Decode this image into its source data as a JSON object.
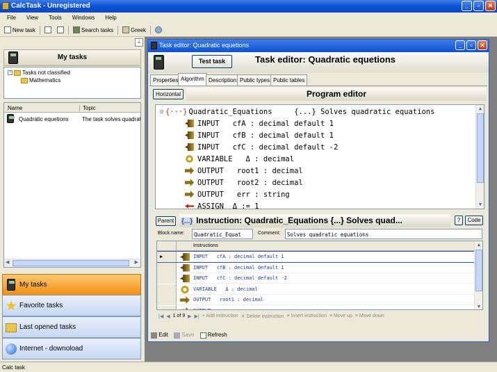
{
  "app": {
    "title": "CalcTask - Unregistered",
    "window_buttons": [
      "_",
      "▫",
      "✕"
    ]
  },
  "menu": [
    "File",
    "View",
    "Tools",
    "Windows",
    "Help"
  ],
  "toolbar": {
    "new_task": "New task",
    "search_tasks": "Search tasks",
    "greek": "Greek"
  },
  "left": {
    "header": "My tasks",
    "tree": {
      "root": "Tasks not classified",
      "child": "Mathematics"
    },
    "list": {
      "columns": [
        "Name",
        "Topic"
      ],
      "rows": [
        {
          "name": "Quadratic equetions",
          "topic": "The task solves quadrati"
        }
      ]
    },
    "nav": [
      "My tasks",
      "Favorite tasks",
      "Last opened tasks",
      "Internet - downoload"
    ]
  },
  "editor": {
    "window_title": "Task editor: Quadratic equetions",
    "test_button": "Test task",
    "heading": "Task editor: Quadratic equetions",
    "tabs": [
      "Properties",
      "Algorithm",
      "Description",
      "Public types",
      "Public tables"
    ],
    "horizontal_button": "Horizontal",
    "program_editor": "Program editor",
    "code_root": "Quadratic_Equations     {...} Solves quadratic equations",
    "code_root_icon": "{···}",
    "code_lines": [
      {
        "text": "INPUT   cfA : decimal default 1",
        "icon": "input"
      },
      {
        "text": "INPUT   cfB : decimal default 1",
        "icon": "input"
      },
      {
        "text": "INPUT   cfC : decimal default -2",
        "icon": "input"
      },
      {
        "text": "VARIABLE   Δ : decimal",
        "icon": "variable"
      },
      {
        "text": "OUTPUT   root1 : decimal",
        "icon": "output"
      },
      {
        "text": "OUTPUT   root2 : decimal",
        "icon": "output"
      },
      {
        "text": "OUTPUT   err : string",
        "icon": "output"
      },
      {
        "text": "ASSIGN  Δ := 1",
        "icon": "assign"
      }
    ],
    "parent_button": "Parent",
    "instruction_icon": "{...}",
    "instruction_title": "Instruction: Quadratic_Equations     {...} Solves quad...",
    "help_button": "?",
    "code_button": "Code",
    "block_name_label": "Block name:",
    "block_name_value": "Quadratic_Equat",
    "comment_label": "Comment:",
    "comment_value": "Solves quadratic equations",
    "grid_header": "Instructions",
    "grid_rows": [
      {
        "text": "INPUT   cfA : decimal default 1",
        "icon": "input",
        "selected": true
      },
      {
        "text": "INPUT   cfB : decimal default 1",
        "icon": "input"
      },
      {
        "text": "INPUT   cfC : decimal default -2",
        "icon": "input"
      },
      {
        "text": "VARIABLE   Δ : decimal",
        "icon": "variable"
      },
      {
        "text": "OUTPUT   root1 : decimal",
        "icon": "output"
      },
      {
        "text": "OUTPUT   ...",
        "icon": "output"
      }
    ],
    "pager": {
      "of_text": "1 of 9",
      "add": "Add instruction",
      "delete": "Delete instruction",
      "insert": "Insert instruction",
      "up": "Move up",
      "down": "Move down"
    },
    "bottom": {
      "edit": "Edit",
      "save": "Save",
      "refresh": "Refresh"
    }
  },
  "status": "Calc task"
}
